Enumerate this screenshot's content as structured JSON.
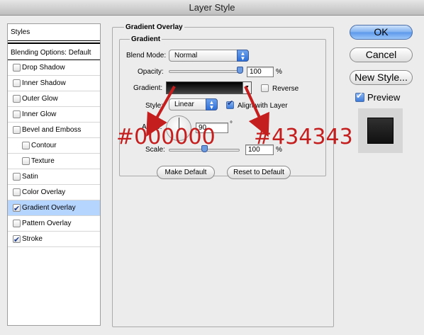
{
  "window": {
    "title": "Layer Style"
  },
  "styles_panel": {
    "header": "Styles",
    "blending_options": "Blending Options: Default",
    "items": [
      {
        "label": "Drop Shadow",
        "checked": false,
        "sub": false
      },
      {
        "label": "Inner Shadow",
        "checked": false,
        "sub": false
      },
      {
        "label": "Outer Glow",
        "checked": false,
        "sub": false
      },
      {
        "label": "Inner Glow",
        "checked": false,
        "sub": false
      },
      {
        "label": "Bevel and Emboss",
        "checked": false,
        "sub": false
      },
      {
        "label": "Contour",
        "checked": false,
        "sub": true
      },
      {
        "label": "Texture",
        "checked": false,
        "sub": true
      },
      {
        "label": "Satin",
        "checked": false,
        "sub": false
      },
      {
        "label": "Color Overlay",
        "checked": false,
        "sub": false
      },
      {
        "label": "Gradient Overlay",
        "checked": true,
        "sub": false,
        "selected": true
      },
      {
        "label": "Pattern Overlay",
        "checked": false,
        "sub": false
      },
      {
        "label": "Stroke",
        "checked": true,
        "sub": false
      }
    ]
  },
  "gradient_overlay": {
    "section_title": "Gradient Overlay",
    "group_title": "Gradient",
    "blend_mode_label": "Blend Mode:",
    "blend_mode_value": "Normal",
    "opacity_label": "Opacity:",
    "opacity_value": "100",
    "opacity_unit": "%",
    "opacity_level": 1.0,
    "gradient_label": "Gradient:",
    "gradient_start_color": "#000000",
    "gradient_end_color": "#434343",
    "reverse_label": "Reverse",
    "reverse_checked": false,
    "style_label": "Style:",
    "style_value": "Linear",
    "align_label": "Align with Layer",
    "align_checked": true,
    "angle_label": "Angle:",
    "angle_value": "90",
    "angle_unit": "°",
    "scale_label": "Scale:",
    "scale_value": "100",
    "scale_unit": "%",
    "scale_level": 0.5,
    "make_default": "Make Default",
    "reset_default": "Reset to Default"
  },
  "buttons": {
    "ok": "OK",
    "cancel": "Cancel",
    "new_style": "New Style...",
    "preview_label": "Preview",
    "preview_checked": true
  },
  "annotations": {
    "color_1": "#000000",
    "color_2": "#434343",
    "annotation_color": "#c41e1e"
  }
}
